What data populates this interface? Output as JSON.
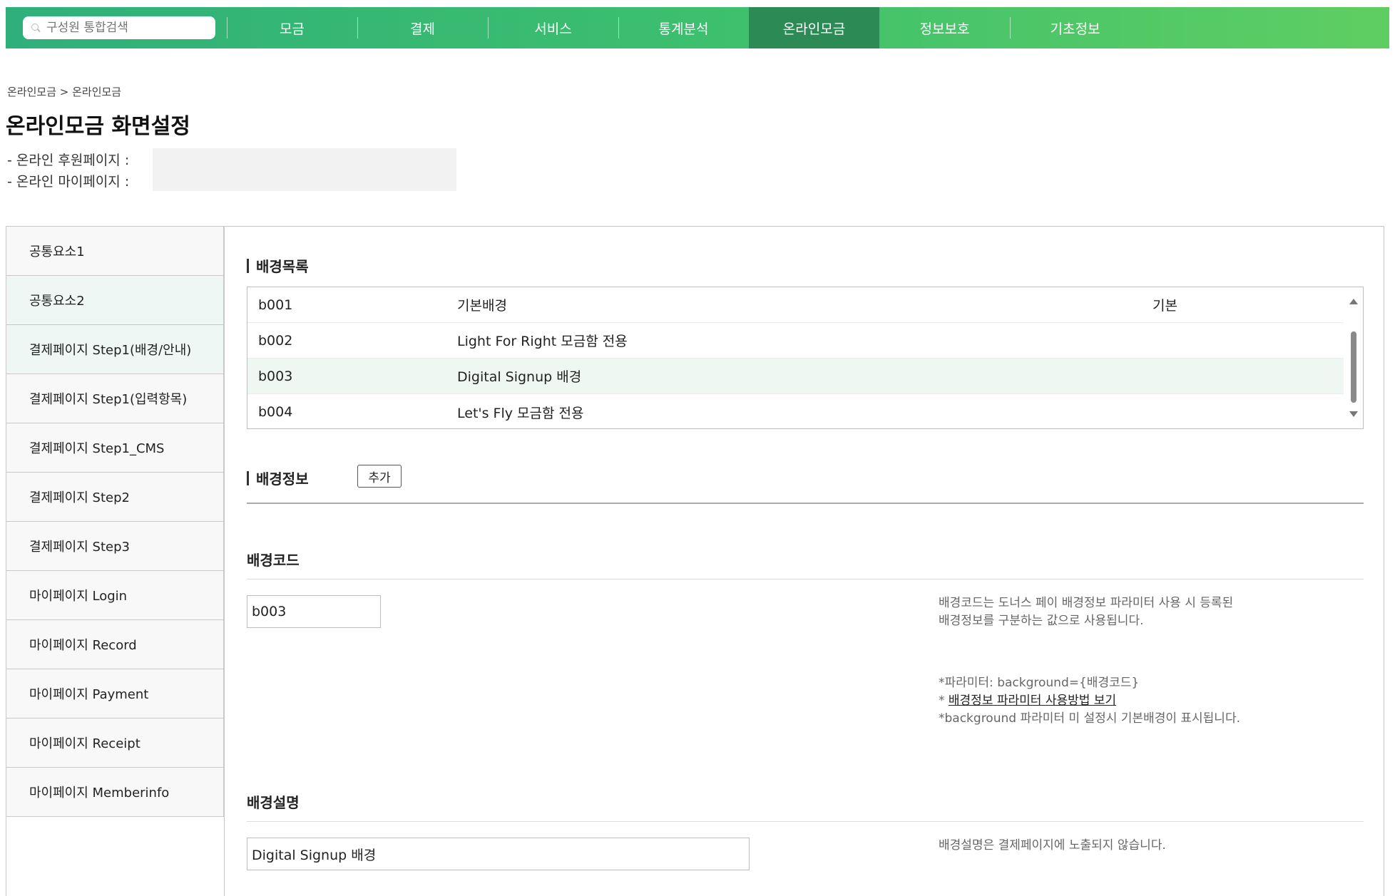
{
  "nav": {
    "search_placeholder": "구성원 통합검색",
    "items": [
      {
        "label": "모금"
      },
      {
        "label": "결제"
      },
      {
        "label": "서비스"
      },
      {
        "label": "통계분석"
      },
      {
        "label": "온라인모금",
        "active": true
      },
      {
        "label": "정보보호"
      },
      {
        "label": "기초정보"
      }
    ]
  },
  "header": {
    "breadcrumb": "온라인모금 > 온라인모금",
    "title": "온라인모금 화면설정",
    "info1": "- 온라인 후원페이지 :",
    "info2": "- 온라인 마이페이지 :"
  },
  "sidebar": {
    "items": [
      {
        "label": "공통요소1"
      },
      {
        "label": "공통요소2"
      },
      {
        "label": "결제페이지 Step1(배경/안내)"
      },
      {
        "label": "결제페이지 Step1(입력항목)"
      },
      {
        "label": "결제페이지 Step1_CMS"
      },
      {
        "label": "결제페이지 Step2"
      },
      {
        "label": "결제페이지 Step3"
      },
      {
        "label": "마이페이지 Login"
      },
      {
        "label": "마이페이지 Record"
      },
      {
        "label": "마이페이지 Payment"
      },
      {
        "label": "마이페이지 Receipt"
      },
      {
        "label": "마이페이지 Memberinfo"
      }
    ]
  },
  "bg_list": {
    "title": "배경목록",
    "rows": [
      {
        "code": "b001",
        "name": "기본배경",
        "flag": "기본"
      },
      {
        "code": "b002",
        "name": "Light For Right 모금함 전용",
        "flag": ""
      },
      {
        "code": "b003",
        "name": "Digital Signup 배경",
        "flag": ""
      },
      {
        "code": "b004",
        "name": "Let's Fly 모금함 전용",
        "flag": ""
      }
    ]
  },
  "bg_info": {
    "title": "배경정보",
    "add_label": "추가",
    "code_label": "배경코드",
    "code_value": "b003",
    "code_help1": "배경코드는 도너스 페이 배경정보 파라미터 사용 시 등록된",
    "code_help2": "배경정보를 구분하는 값으로 사용됩니다.",
    "param_line": "*파라미터: background={배경코드}",
    "param_link_prefix": "* ",
    "param_link": "배경정보 파라미터 사용방법 보기",
    "param_note": "*background 파라미터 미 설정시 기본배경이 표시됩니다.",
    "desc_label": "배경설명",
    "desc_value": "Digital Signup 배경",
    "desc_help": "배경설명은 결제페이지에 노출되지 않습니다."
  },
  "colors": {
    "nav_start": "#2fb07a",
    "nav_end": "#5fce62",
    "nav_active": "#2c8a55",
    "row_selected": "#eef7f2"
  }
}
